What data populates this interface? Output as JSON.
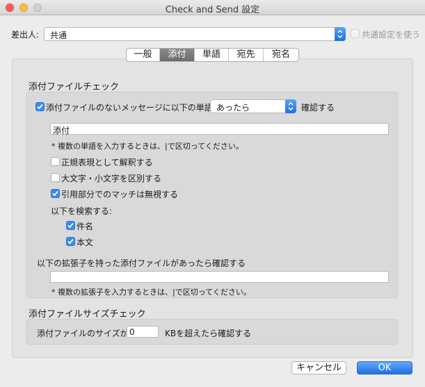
{
  "window": {
    "title": "Check and Send 設定"
  },
  "sender": {
    "label": "差出人:",
    "value": "共通",
    "use_common_label": "共通設定を使う"
  },
  "tabs": [
    {
      "label": "一般",
      "active": false
    },
    {
      "label": "添付",
      "active": true
    },
    {
      "label": "単語",
      "active": false
    },
    {
      "label": "宛先",
      "active": false
    },
    {
      "label": "宛名",
      "active": false
    }
  ],
  "attachment_check": {
    "title": "添付ファイルチェック",
    "no_attachment_label": "添付ファイルのないメッセージに以下の単語が",
    "condition_value": "あったら",
    "confirm_label": "確認する",
    "words_value": "添付",
    "words_note": "* 複数の単語を入力するときは、|で区切ってください。",
    "regex_label": "正規表現として解釈する",
    "case_label": "大文字・小文字を区別する",
    "ignore_quote_label": "引用部分でのマッチは無視する",
    "search_label": "以下を検索する:",
    "subject_label": "件名",
    "body_label": "本文",
    "ext_label": "以下の拡張子を持った添付ファイルがあったら確認する",
    "ext_value": "",
    "ext_note": "* 複数の拡張子を入力するときは、|で区切ってください。"
  },
  "size_check": {
    "title": "添付ファイルサイズチェック",
    "prefix_label": "添付ファイルのサイズが",
    "size_value": "0",
    "suffix_label": "KBを超えたら確認する"
  },
  "buttons": {
    "cancel": "キャンセル",
    "ok": "OK"
  },
  "checkboxes": {
    "use_common": false,
    "no_attachment": true,
    "regex": false,
    "case": false,
    "ignore_quote": true,
    "subject": true,
    "body": true
  },
  "colors": {
    "accent": "#3b8ced",
    "ok_button": "#1c6ee4",
    "close": "#fc605b",
    "minimize": "#fdbc40"
  }
}
